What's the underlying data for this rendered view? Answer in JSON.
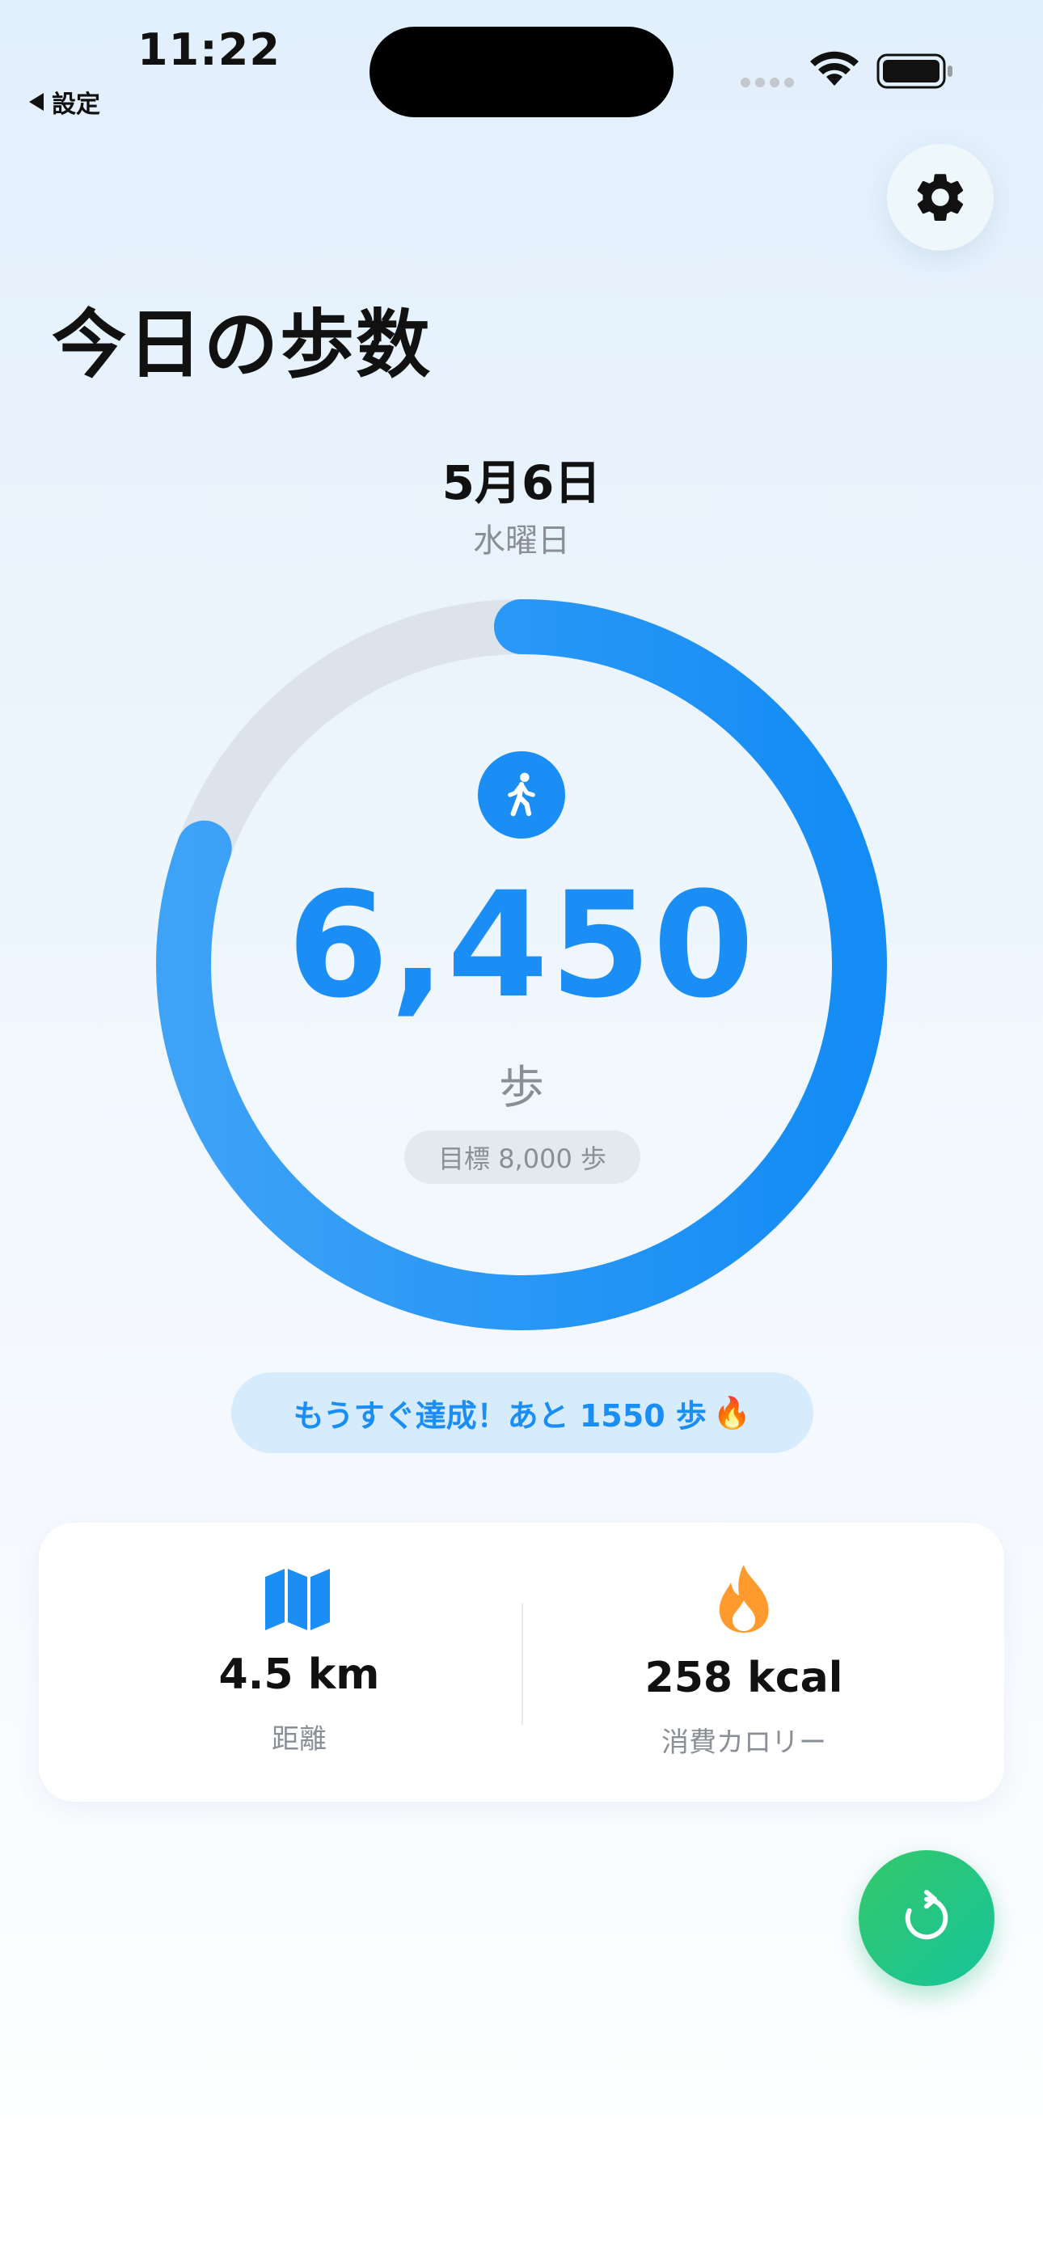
{
  "status_bar": {
    "time": "11:22",
    "back_label": "設定"
  },
  "header": {
    "title": "今日の歩数"
  },
  "date": {
    "day": "5月6日",
    "weekday": "水曜日"
  },
  "progress": {
    "steps": "6,450",
    "unit": "歩",
    "goal_label": "目標 8,000 歩",
    "fraction": 0.806,
    "accent_color": "#1a8ef5",
    "track_color": "#dde3ea"
  },
  "message": {
    "text": "もうすぐ達成！あと 1550 歩",
    "emoji": "🔥"
  },
  "stats": {
    "distance": {
      "value": "4.5 km",
      "label": "距離",
      "icon": "map-icon"
    },
    "calories": {
      "value": "258 kcal",
      "label": "消費カロリー",
      "icon": "flame-icon"
    }
  },
  "icons": {
    "settings": "gear-icon",
    "walk": "walking-person-icon",
    "refresh": "refresh-icon"
  }
}
